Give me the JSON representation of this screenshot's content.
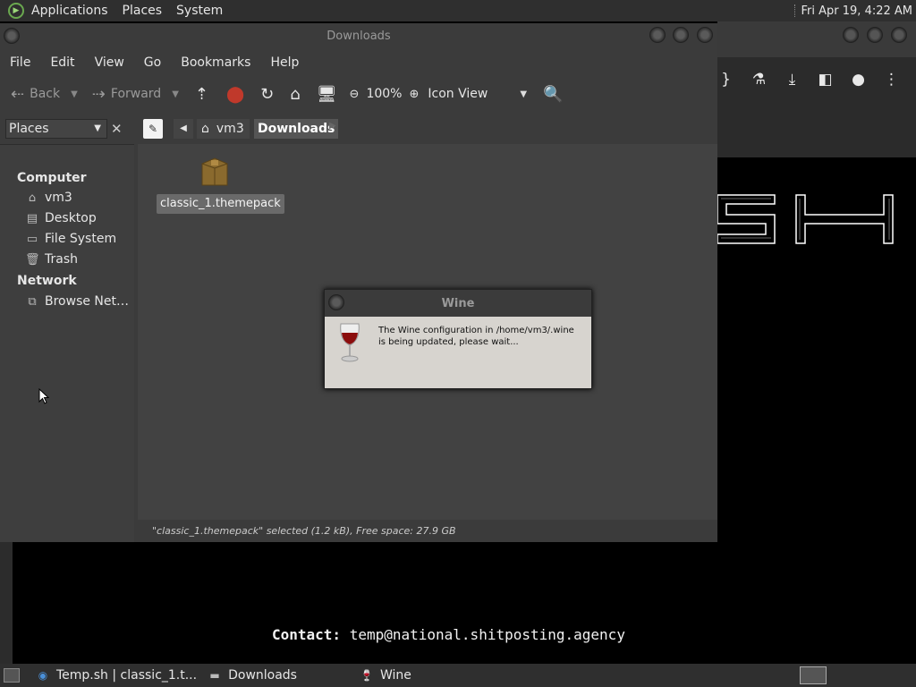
{
  "top_panel": {
    "menus": [
      "Applications",
      "Places",
      "System"
    ],
    "clock": "Fri Apr 19,  4:22 AM"
  },
  "file_manager": {
    "title": "Downloads",
    "menubar": [
      "File",
      "Edit",
      "View",
      "Go",
      "Bookmarks",
      "Help"
    ],
    "toolbar": {
      "back": "Back",
      "forward": "Forward",
      "zoom": "100%",
      "view_mode": "Icon View"
    },
    "location": {
      "places_label": "Places",
      "crumbs": [
        "vm3",
        "Downloads"
      ]
    },
    "sidebar": {
      "computer_header": "Computer",
      "computer_items": [
        "vm3",
        "Desktop",
        "File System",
        "Trash"
      ],
      "network_header": "Network",
      "network_items": [
        "Browse Net…"
      ]
    },
    "files": [
      {
        "name": "classic_1.themepack",
        "icon": "package-icon"
      }
    ],
    "status": "\"classic_1.themepack\" selected (1.2 kB), Free space: 27.9 GB"
  },
  "wine_dialog": {
    "title": "Wine",
    "message": "The Wine configuration in /home/vm3/.wine is being updated, please wait..."
  },
  "terminal": {
    "contact_label": "Contact:",
    "contact_value": " temp@national.shitposting.agency",
    "logo_text": "SH"
  },
  "taskbar": {
    "items": [
      "Temp.sh | classic_1.t...",
      "Downloads",
      "Wine"
    ]
  },
  "colors": {
    "panel": "#2f2f2f",
    "window": "#3b3b3b",
    "dialog": "#d7d4cf"
  }
}
